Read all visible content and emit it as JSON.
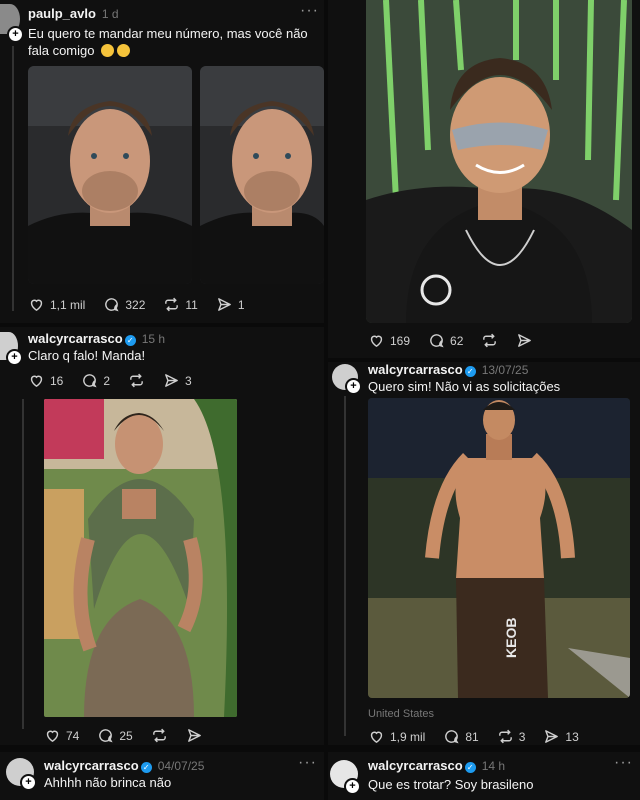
{
  "posts": {
    "p1": {
      "username": "paulp_avlo",
      "time": "1 d",
      "text": "Eu quero te mandar meu número, mas você não fala comigo",
      "emoji": [
        "relieved-face",
        "relieved-face"
      ],
      "likes": "1,1 mil",
      "comments": "322",
      "reposts": "11",
      "shares": "1"
    },
    "p2": {
      "likes": "169",
      "comments": "62"
    },
    "p3": {
      "username": "walcyrcarrasco",
      "time": "15 h",
      "text": "Claro q falo! Manda!",
      "likes": "16",
      "comments": "2",
      "shares": "3"
    },
    "p4": {
      "username": "walcyrcarrasco",
      "time": "13/07/25",
      "text": "Quero sim! Não vi as solicitações"
    },
    "p5": {
      "likes": "74",
      "comments": "25"
    },
    "p6": {
      "location": "United States",
      "likes": "1,9 mil",
      "comments": "81",
      "reposts": "3",
      "shares": "13"
    },
    "p7": {
      "username": "walcyrcarrasco",
      "time": "04/07/25",
      "text": "Ahhhh não brinca não"
    },
    "p8": {
      "username": "walcyrcarrasco",
      "time": "14 h",
      "text": "Que es trotar? Soy brasileno"
    }
  },
  "icons": {
    "like": "heart-icon",
    "comment": "comment-icon",
    "repost": "repost-icon",
    "share": "send-icon",
    "verified": "verified-badge-icon",
    "more": "more-icon"
  },
  "colors": {
    "background": "#101010",
    "text": "#f3f3f3",
    "muted": "#777777",
    "verified": "#1d9bf0"
  }
}
